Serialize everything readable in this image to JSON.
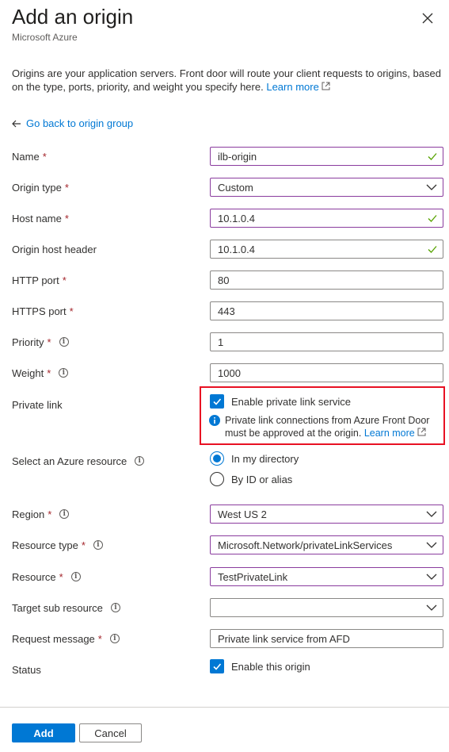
{
  "header": {
    "title": "Add an origin",
    "subtitle": "Microsoft Azure"
  },
  "description": {
    "text": "Origins are your application servers. Front door will route your client requests to origins, based on the type, ports, priority, and weight you specify here.",
    "link": "Learn more"
  },
  "back_link": "Go back to origin group",
  "fields": {
    "name": {
      "label": "Name",
      "value": "ilb-origin"
    },
    "origin_type": {
      "label": "Origin type",
      "value": "Custom"
    },
    "host_name": {
      "label": "Host name",
      "value": "10.1.0.4"
    },
    "origin_host_header": {
      "label": "Origin host header",
      "value": "10.1.0.4"
    },
    "http_port": {
      "label": "HTTP port",
      "value": "80"
    },
    "https_port": {
      "label": "HTTPS port",
      "value": "443"
    },
    "priority": {
      "label": "Priority",
      "value": "1"
    },
    "weight": {
      "label": "Weight",
      "value": "1000"
    },
    "private_link": {
      "label": "Private link",
      "checkbox_label": "Enable private link service",
      "info_text": "Private link connections from Azure Front Door must be approved at the origin.",
      "info_link": "Learn more"
    },
    "azure_resource": {
      "label": "Select an Azure resource",
      "options": [
        "In my directory",
        "By ID or alias"
      ],
      "selected": "In my directory"
    },
    "region": {
      "label": "Region",
      "value": "West US 2"
    },
    "resource_type": {
      "label": "Resource type",
      "value": "Microsoft.Network/privateLinkServices"
    },
    "resource": {
      "label": "Resource",
      "value": "TestPrivateLink"
    },
    "target_sub_resource": {
      "label": "Target sub resource",
      "value": ""
    },
    "request_message": {
      "label": "Request message",
      "value": "Private link service from AFD"
    },
    "status": {
      "label": "Status",
      "checkbox_label": "Enable this origin"
    }
  },
  "required_marker": "*",
  "info_glyph": "i",
  "footer": {
    "add_label": "Add",
    "cancel_label": "Cancel"
  },
  "colors": {
    "accent": "#0078d4",
    "required": "#a4262c",
    "valid_check": "#57a300",
    "highlight_box": "#e81123"
  }
}
